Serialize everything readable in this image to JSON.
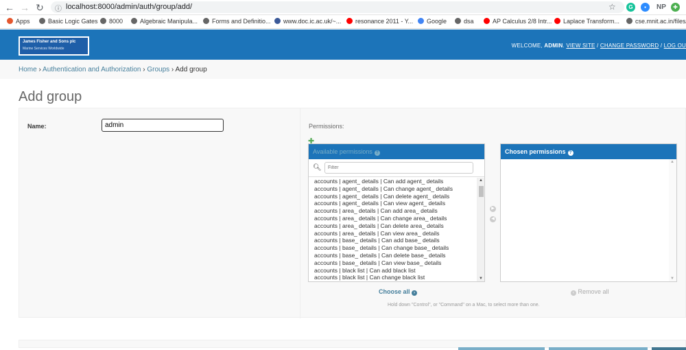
{
  "browser": {
    "url": "localhost:8000/admin/auth/group/add/",
    "bookmarks": [
      {
        "label": "Apps",
        "color": "#e4572e"
      },
      {
        "label": "Basic Logic Gates",
        "color": "#666666"
      },
      {
        "label": "8000",
        "color": "#666666"
      },
      {
        "label": "Algebraic Manipula...",
        "color": "#666666"
      },
      {
        "label": "Forms and Definitio...",
        "color": "#666666"
      },
      {
        "label": "www.doc.ic.ac.uk/~...",
        "color": "#3b5998"
      },
      {
        "label": "resonance 2011 - Y...",
        "color": "#ff0000"
      },
      {
        "label": "Google",
        "color": "#4285f4"
      },
      {
        "label": "dsa",
        "color": "#666666"
      },
      {
        "label": "AP Calculus 2/8 Intr...",
        "color": "#ff0000"
      },
      {
        "label": "Laplace Transform...",
        "color": "#ff0000"
      },
      {
        "label": "cse.mnit.ac.in/files/...",
        "color": "#666666"
      }
    ],
    "ext_np": "NP"
  },
  "header": {
    "logo_line1": "James Fisher and Sons plc",
    "logo_line2": "Marine Services Worldwide",
    "welcome": "WELCOME, ",
    "username": "ADMIN",
    "view_site": "VIEW SITE",
    "change_password": "CHANGE PASSWORD",
    "logout": "LOG OU"
  },
  "breadcrumbs": {
    "home": "Home",
    "app": "Authentication and Authorization",
    "model": "Groups",
    "current": "Add group",
    "sep": " › "
  },
  "page": {
    "title": "Add group"
  },
  "form": {
    "name_label": "Name:",
    "name_value": "admin",
    "permissions_label": "Permissions:",
    "available_title": "Available permissions",
    "chosen_title": "Chosen permissions",
    "filter_placeholder": "Filter",
    "choose_all": "Choose all",
    "remove_all": "Remove all",
    "help_text": "Hold down \"Control\", or \"Command\" on a Mac, to select more than one.",
    "available_permissions": [
      "accounts | agent_ details | Can add agent_ details",
      "accounts | agent_ details | Can change agent_ details",
      "accounts | agent_ details | Can delete agent_ details",
      "accounts | agent_ details | Can view agent_ details",
      "accounts | area_ details | Can add area_ details",
      "accounts | area_ details | Can change area_ details",
      "accounts | area_ details | Can delete area_ details",
      "accounts | area_ details | Can view area_ details",
      "accounts | base_ details | Can add base_ details",
      "accounts | base_ details | Can change base_ details",
      "accounts | base_ details | Can delete base_ details",
      "accounts | base_ details | Can view base_ details",
      "accounts | black list | Can add black list",
      "accounts | black list | Can change black list"
    ]
  }
}
